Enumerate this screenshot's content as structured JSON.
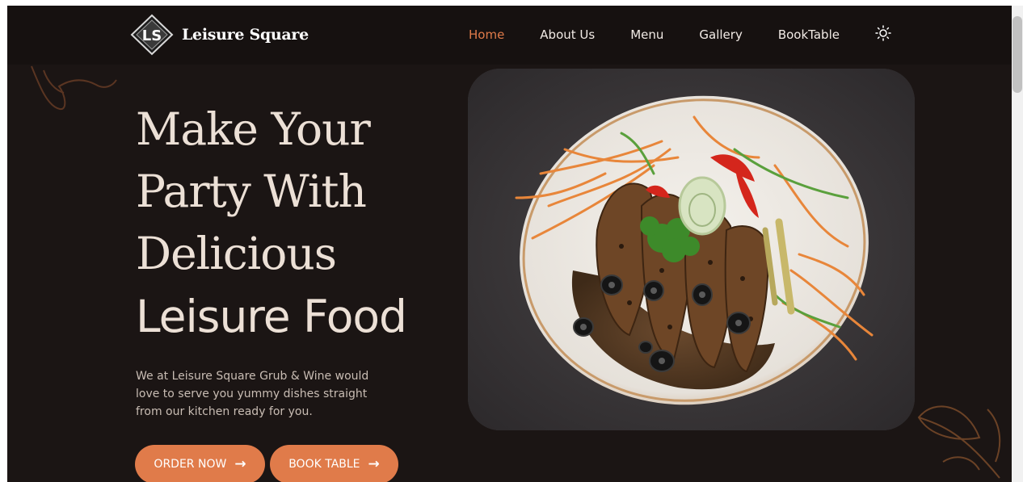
{
  "navbar": {
    "brand_name": "Leisure Square",
    "logo_text": "LS",
    "links": [
      {
        "label": "Home",
        "active": true
      },
      {
        "label": "About Us",
        "active": false
      },
      {
        "label": "Menu",
        "active": false
      },
      {
        "label": "Gallery",
        "active": false
      },
      {
        "label": "BookTable",
        "active": false
      }
    ],
    "theme_toggle_icon": "sun-icon"
  },
  "hero": {
    "line1": "Make Your",
    "line2": "Party With",
    "line3": "Delicious",
    "line4": "Leisure Food",
    "description": "We at Leisure Square Grub & Wine would love to serve you yummy dishes straight from our kitchen ready for you.",
    "order_button": "ORDER NOW",
    "book_button": "BOOK TABLE",
    "image_icon": "plated-steak-dish-image"
  },
  "colors": {
    "accent": "#e07b4a",
    "background": "#1b1514",
    "navbar": "#161110",
    "heading": "#ece0d6"
  }
}
